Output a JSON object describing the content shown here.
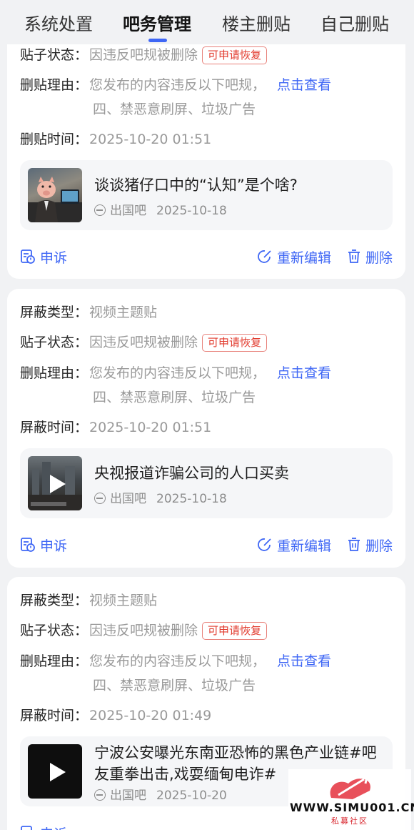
{
  "tabs": [
    {
      "label": "系统处置"
    },
    {
      "label": "吧务管理"
    },
    {
      "label": "楼主删贴"
    },
    {
      "label": "自己删贴"
    }
  ],
  "labels": {
    "block_type": "屏蔽类型：",
    "post_status": "贴子状态：",
    "delete_reason": "删贴理由：",
    "delete_time": "删贴时间：",
    "block_time": "屏蔽时间：",
    "view_link": "点击查看"
  },
  "actions": {
    "appeal": "申诉",
    "reedit": "重新编辑",
    "delete": "删除"
  },
  "cards": [
    {
      "status": "因违反吧规被删除",
      "status_tag": "可申请恢复",
      "reason": "您发布的内容违反以下吧规，",
      "reason_detail": "四、禁恶意刷屏、垃圾广告",
      "time": "2025-10-20 01:51",
      "post": {
        "title": "谈谈猪仔口中的“认知”是个啥?",
        "bar": "出国吧",
        "date": "2025-10-18",
        "thumb_icon": "pig-office-image"
      }
    },
    {
      "block_type": "视频主题贴",
      "status": "因违反吧规被删除",
      "status_tag": "可申请恢复",
      "reason": "您发布的内容违反以下吧规，",
      "reason_detail": "四、禁恶意刷屏、垃圾广告",
      "time": "2025-10-20 01:51",
      "post": {
        "title": "央视报道诈骗公司的人口买卖",
        "bar": "出国吧",
        "date": "2025-10-18",
        "thumb_icon": "video-play-icon"
      }
    },
    {
      "block_type": "视频主题贴",
      "status": "因违反吧规被删除",
      "status_tag": "可申请恢复",
      "reason": "您发布的内容违反以下吧规，",
      "reason_detail": "四、禁恶意刷屏、垃圾广告",
      "time": "2025-10-20 01:49",
      "post": {
        "title": "宁波公安曝光东南亚恐怖的黑色产业链#吧友重拳出击,戏耍缅甸电诈#",
        "bar": "出国吧",
        "date": "2025-10-20",
        "thumb_icon": "video-play-icon"
      }
    }
  ],
  "watermark": {
    "text": "WWW.SIMU001.CN",
    "sub": "私募社区"
  },
  "colors": {
    "accent": "#3f67f5",
    "tag_red": "#e23b2e",
    "page_bg": "#f1f2f4"
  }
}
